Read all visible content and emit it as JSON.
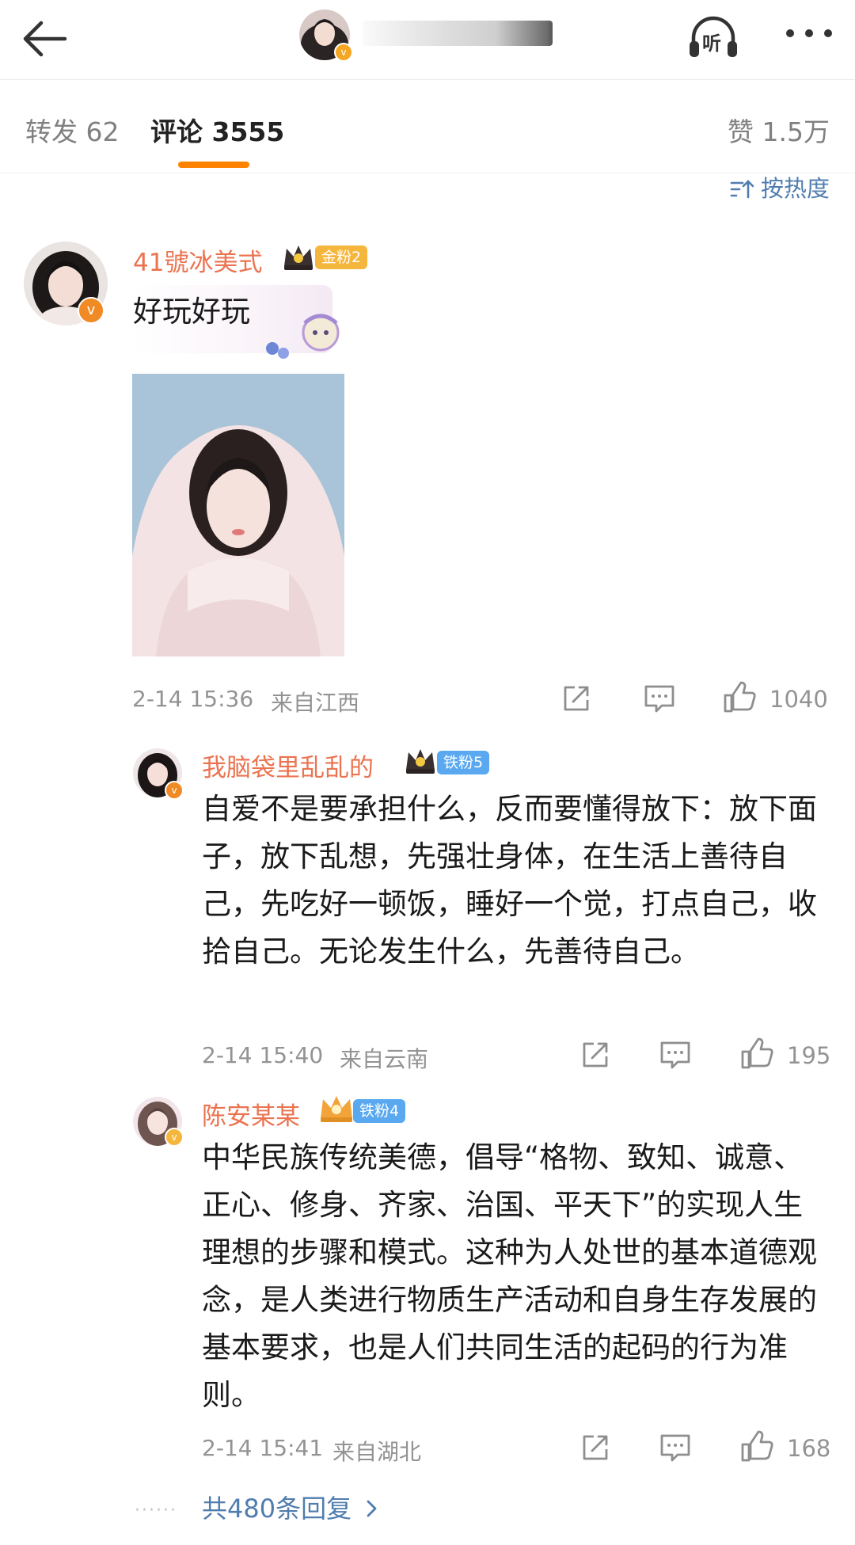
{
  "header": {
    "back_icon": "arrow-left-icon",
    "listen_label": "听",
    "more_icon": "more-dots-icon"
  },
  "tabs": {
    "repost": "转发 62",
    "comments": "评论 3555",
    "likes": "赞 1.5万",
    "active_color": "#ff8200"
  },
  "sort_label": "按热度",
  "comments": [
    {
      "username": "41號冰美式",
      "badge": "金粉2",
      "badge_color": "#f5b63d",
      "text": "好玩好玩",
      "time": "2-14 15:36",
      "location": "来自江西",
      "likes": "1040"
    }
  ],
  "replies": [
    {
      "username": "我脑袋里乱乱的",
      "badge": "铁粉5",
      "badge_color": "#5aa9f0",
      "text": "自爱不是要承担什么，反而要懂得放下：放下面子，放下乱想，先强壮身体，在生活上善待自己，先吃好一顿饭，睡好一个觉，打点自己，收拾自己。无论发生什么，先善待自己。",
      "time": "2-14 15:40",
      "location": "来自云南",
      "likes": "195"
    },
    {
      "username": "陈安某某",
      "badge": "铁粉4",
      "badge_color": "#5aa9f0",
      "text": "中华民族传统美德，倡导“格物、致知、诚意、正心、修身、齐家、治国、平天下”的实现人生理想的步骤和模式。这种为人处世的基本道德观念，是人类进行物质生产活动和自身生存发展的基本要求，也是人们共同生活的起码的行为准则。",
      "time": "2-14 15:41",
      "location": "来自湖北",
      "likes": "168"
    }
  ],
  "more_replies": "共480条回复",
  "colors": {
    "username": "#eb7350",
    "link": "#507daf",
    "meta": "#939393"
  }
}
